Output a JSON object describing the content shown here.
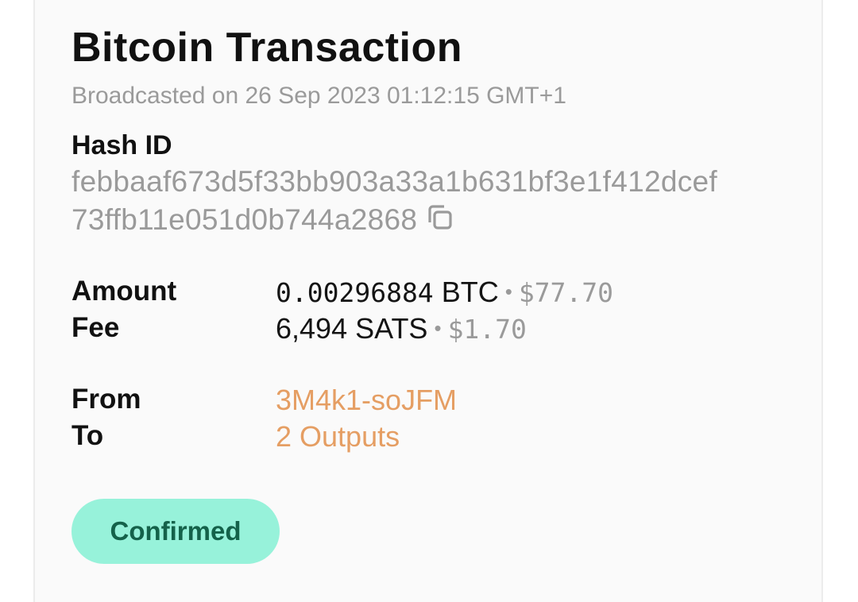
{
  "transaction": {
    "title": "Bitcoin Transaction",
    "broadcasted": "Broadcasted on 26 Sep 2023 01:12:15 GMT+1",
    "hash_label": "Hash ID",
    "hash_line_1": "febbaaf673d5f33bb903a33a1b631bf3e1f412dcef",
    "hash_line_2": "73ffb11e051d0b744a2868",
    "copy_icon": "copy-icon"
  },
  "amount": {
    "label": "Amount",
    "value": "0.00296884",
    "unit": " BTC",
    "separator": "•",
    "fiat": "$77.70"
  },
  "fee": {
    "label": "Fee",
    "value": "6,494 SATS",
    "separator": "•",
    "fiat": "$1.70"
  },
  "from": {
    "label": "From",
    "value": "3M4k1-soJFM"
  },
  "to": {
    "label": "To",
    "value": "2 Outputs"
  },
  "status": {
    "label": "Confirmed",
    "background": "#97f2da",
    "text_color": "#14624a"
  },
  "colors": {
    "link": "#e59e63",
    "muted": "#9a9a9a",
    "text": "#111111"
  }
}
